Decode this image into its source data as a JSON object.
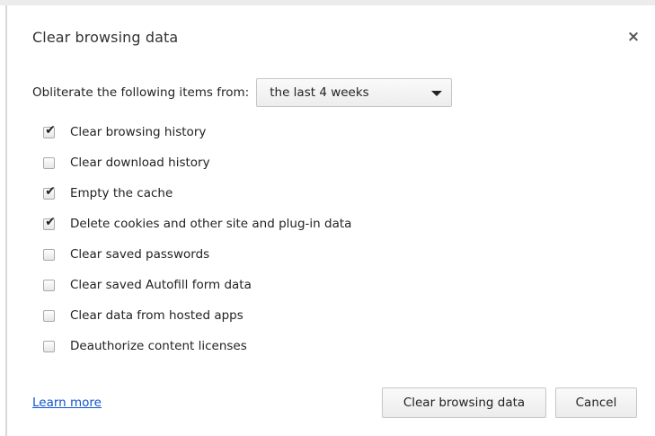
{
  "dialog": {
    "title": "Clear browsing data",
    "close_icon": "close-icon",
    "close_glyph": "×"
  },
  "time_range": {
    "label": "Obliterate the following items from:",
    "selected": "the last 4 weeks"
  },
  "options": [
    {
      "label": "Clear browsing history",
      "checked": true
    },
    {
      "label": "Clear download history",
      "checked": false
    },
    {
      "label": "Empty the cache",
      "checked": true
    },
    {
      "label": "Delete cookies and other site and plug-in data",
      "checked": true
    },
    {
      "label": "Clear saved passwords",
      "checked": false
    },
    {
      "label": "Clear saved Autofill form data",
      "checked": false
    },
    {
      "label": "Clear data from hosted apps",
      "checked": false
    },
    {
      "label": "Deauthorize content licenses",
      "checked": false
    }
  ],
  "footer": {
    "learn_more": "Learn more",
    "clear_button": "Clear browsing data",
    "cancel_button": "Cancel"
  },
  "colors": {
    "link": "#1155cc",
    "text": "#222222"
  }
}
